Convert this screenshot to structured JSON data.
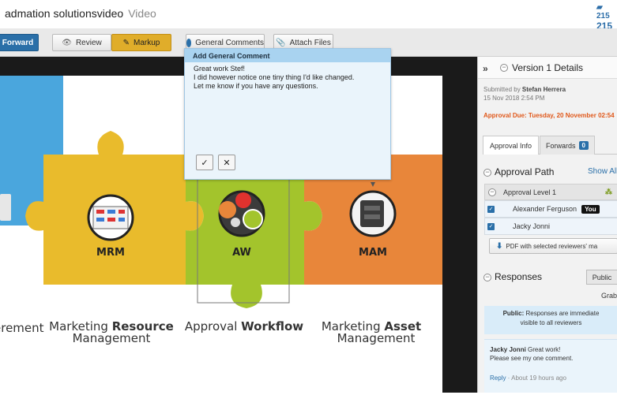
{
  "header": {
    "app_name": "admation solutionsvideo",
    "app_sub": "Video",
    "code_line1": "215",
    "code_line2": "215"
  },
  "toolbar": {
    "forward": "Forward",
    "review": "Review",
    "markup": "Markup",
    "general_comments": "General Comments",
    "attach_files": "Attach Files"
  },
  "artwork": {
    "pieces": [
      {
        "code": "",
        "caption_pre": "",
        "caption_bold": "erement",
        "caption_line2": ""
      },
      {
        "code": "MRM",
        "caption_pre": "Marketing ",
        "caption_bold": "Resource",
        "caption_line2": "Management"
      },
      {
        "code": "AW",
        "caption_pre": "Approval ",
        "caption_bold": "Workflow",
        "caption_line2": ""
      },
      {
        "code": "MAM",
        "caption_pre": "Marketing ",
        "caption_bold": "Asset",
        "caption_line2": "Management"
      }
    ],
    "colors": {
      "blue": "#4aa6dd",
      "yellow": "#e9bb2c",
      "green": "#a3c42c",
      "orange": "#e8863a"
    }
  },
  "popup": {
    "title": "Add General Comment",
    "lines": [
      "Great work Stef!",
      "I did however notice one tiny thing I'd like changed.",
      "Let me know if you have any questions."
    ],
    "confirm_icon": "check-icon",
    "cancel_icon": "close-icon"
  },
  "panel": {
    "version_title": "Version 1 Details",
    "submitted_prefix": "Submitted by ",
    "submitted_by": "Stefan Herrera",
    "submitted_date": "15 Nov 2018 2:54 PM",
    "approval_due": "Approval Due: Tuesday, 20 November 02:54",
    "tabs": {
      "approval_info": "Approval Info",
      "forwards": "Forwards",
      "forwards_count": "0"
    },
    "approval_path": {
      "title": "Approval Path",
      "show_all": "Show All",
      "level": "Approval Level 1",
      "reviewers": [
        {
          "name": "Alexander Ferguson",
          "badge": "You"
        },
        {
          "name": "Jacky Jonni",
          "badge": ""
        }
      ],
      "pdf_button": "PDF with selected reviewers' ma"
    },
    "responses": {
      "title": "Responses",
      "public_btn": "Public",
      "grab": "Grab",
      "note_bold": "Public:",
      "note_line1": " Responses are immediate",
      "note_line2": "visible to all reviewers",
      "comment_author": "Jacky Jonni",
      "comment_line1": " Great work!",
      "comment_line2": "Please see my one comment.",
      "reply": "Reply",
      "time": " · About 19 hours ago"
    }
  },
  "accent": "#2a6fa8",
  "due_color": "#e0581a"
}
